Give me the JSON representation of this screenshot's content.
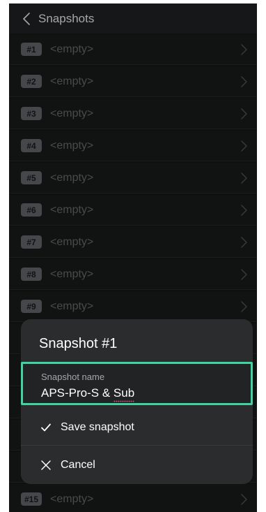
{
  "header": {
    "title": "Snapshots"
  },
  "slots": [
    {
      "badge": "#1",
      "label": "<empty>"
    },
    {
      "badge": "#2",
      "label": "<empty>"
    },
    {
      "badge": "#3",
      "label": "<empty>"
    },
    {
      "badge": "#4",
      "label": "<empty>"
    },
    {
      "badge": "#5",
      "label": "<empty>"
    },
    {
      "badge": "#6",
      "label": "<empty>"
    },
    {
      "badge": "#7",
      "label": "<empty>"
    },
    {
      "badge": "#8",
      "label": "<empty>"
    },
    {
      "badge": "#9",
      "label": "<empty>"
    },
    {
      "badge": "#15",
      "label": "<empty>"
    }
  ],
  "dialog": {
    "title": "Snapshot #1",
    "field_label": "Snapshot name",
    "field_value": "APS-Pro-S & Sub",
    "save_label": "Save snapshot",
    "cancel_label": "Cancel"
  },
  "colors": {
    "accent": "#3ed6a0",
    "background": "#161718",
    "dialog": "#2b2c2e"
  },
  "icons": {
    "back": "chevron-left-icon",
    "row": "chevron-right-icon",
    "save": "checkmark-icon",
    "cancel": "close-icon"
  }
}
